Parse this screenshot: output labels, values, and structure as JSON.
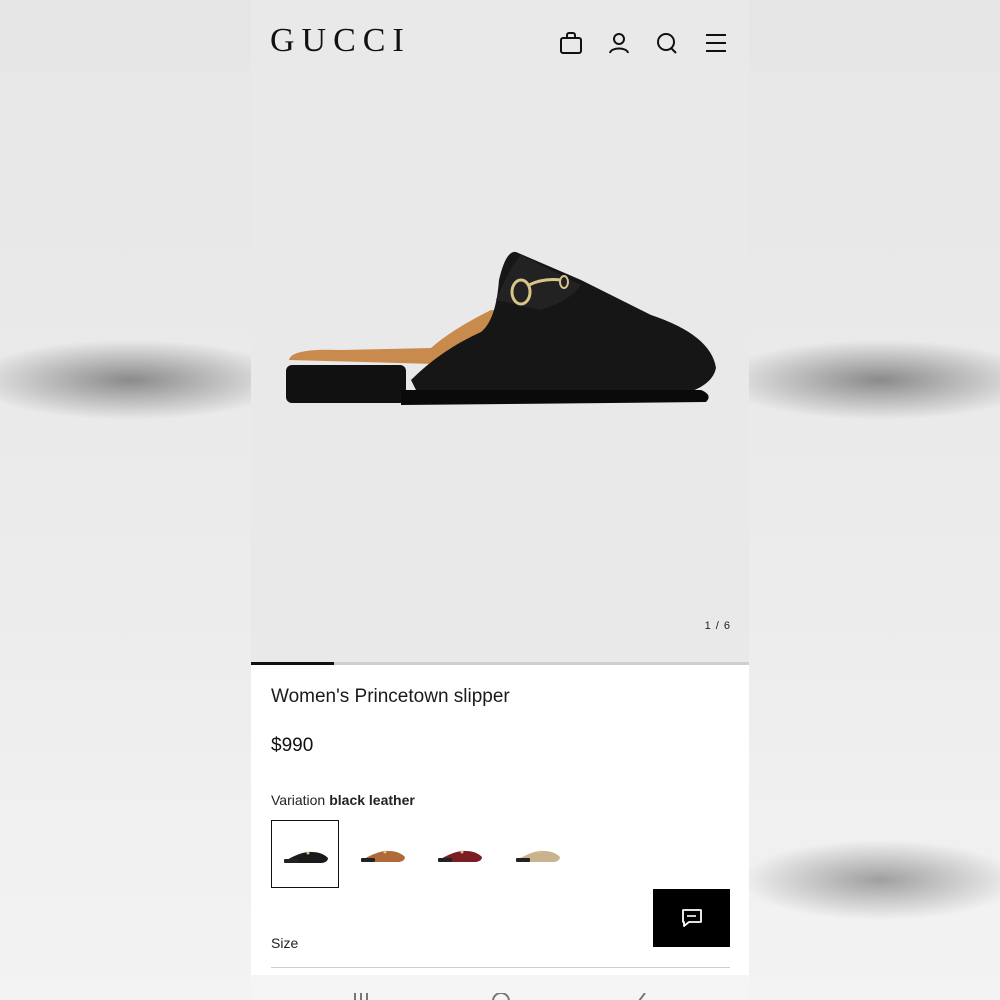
{
  "header": {
    "brand": "GUCCI",
    "icons": [
      "shopping-bag-icon",
      "user-icon",
      "search-icon",
      "menu-icon"
    ]
  },
  "gallery": {
    "counter": "1 / 6",
    "current": 1,
    "total": 6
  },
  "product": {
    "name": "Women's Princetown slipper",
    "price": "$990",
    "variation_label": "Variation",
    "variation_value": "black leather",
    "variations": [
      {
        "name": "black leather",
        "color": "#1a1a1a",
        "selected": true
      },
      {
        "name": "tan leather",
        "color": "#b06a3a",
        "selected": false
      },
      {
        "name": "burgundy leather",
        "color": "#7a1e24",
        "selected": false
      },
      {
        "name": "beige leather",
        "color": "#c9b28e",
        "selected": false
      }
    ],
    "size_label": "Size"
  },
  "colors": {
    "hero_bg": "#e9e9e9",
    "accent": "#000000"
  }
}
